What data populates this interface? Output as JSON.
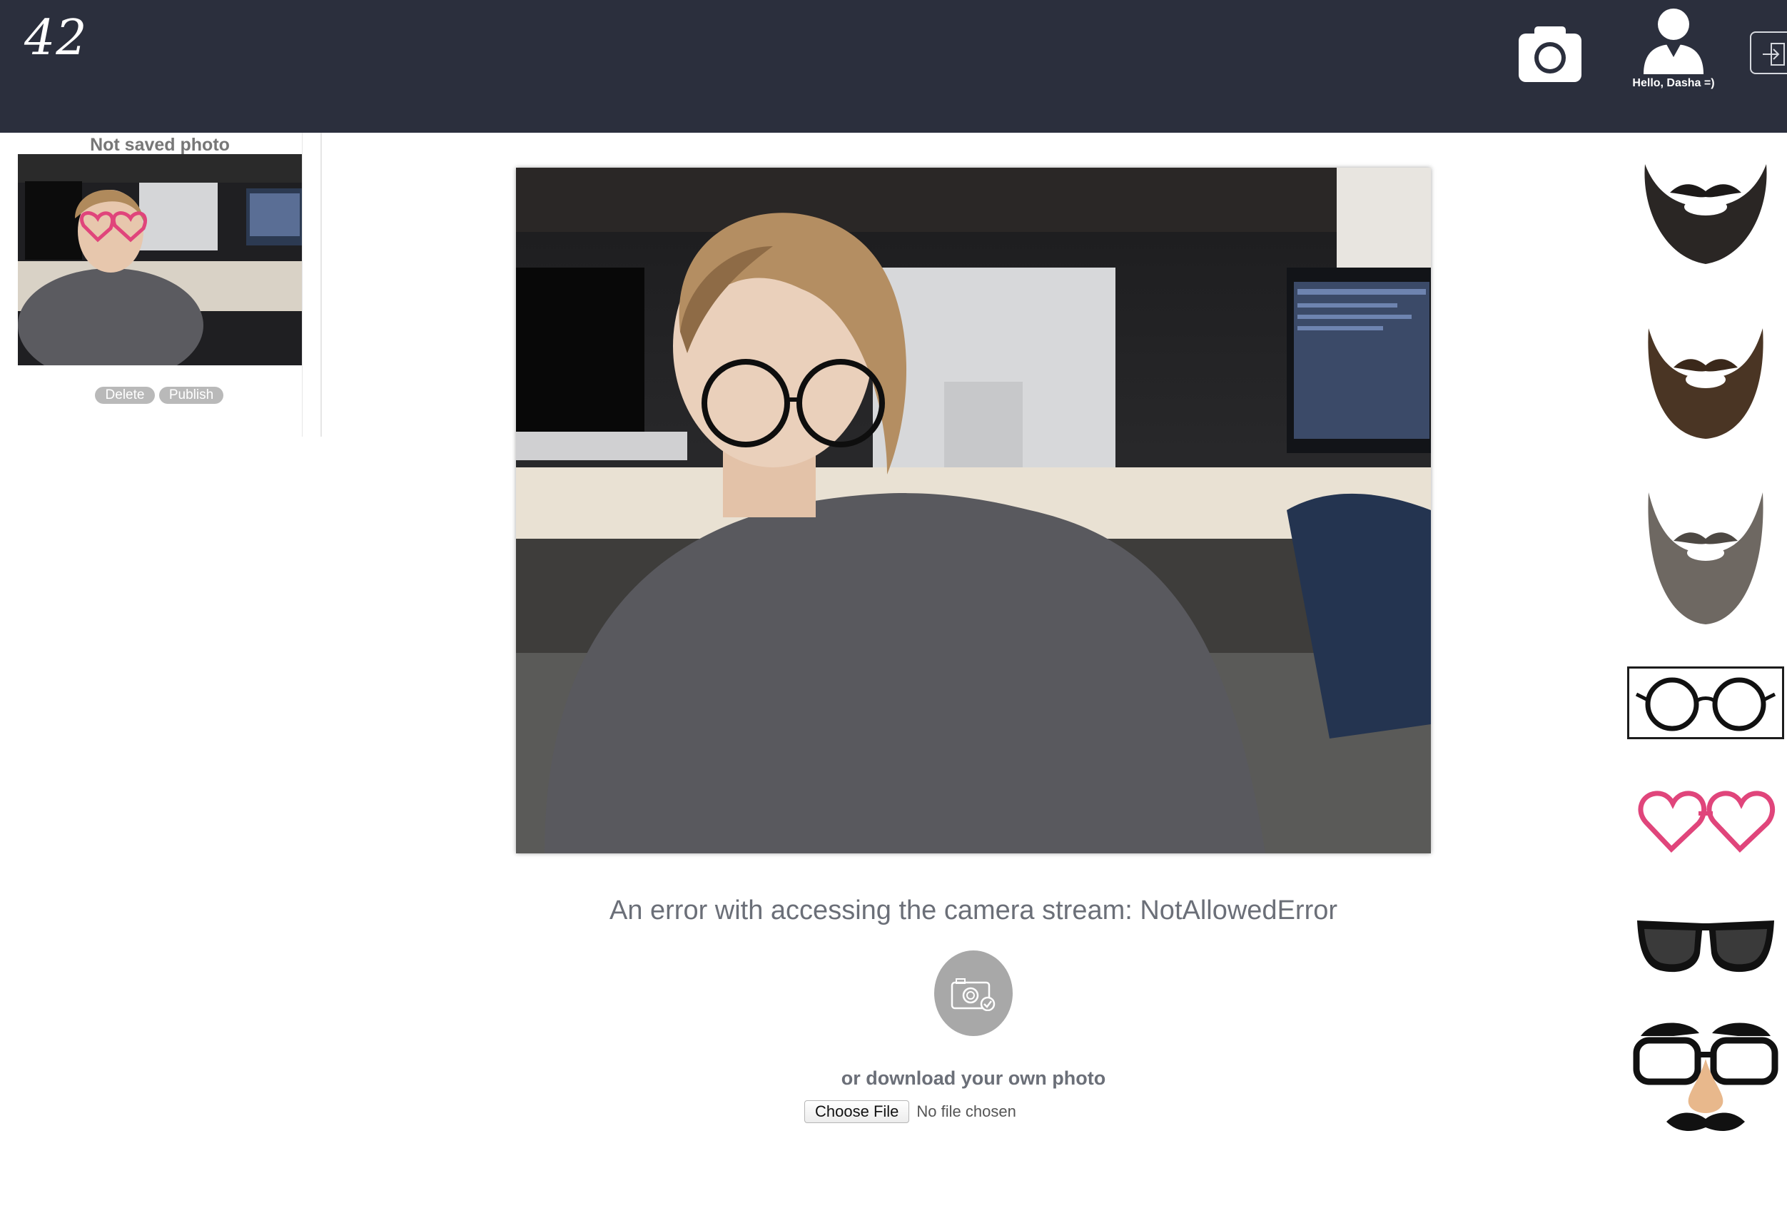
{
  "header": {
    "logo_text": "42",
    "camera_button_icon": "camera-icon",
    "user_icon": "user-icon",
    "greeting": "Hello, Dasha =)",
    "logout_icon": "logout-icon"
  },
  "gallery": {
    "title": "Not saved photo",
    "delete_label": "Delete",
    "publish_label": "Publish"
  },
  "main": {
    "error_message": "An error with accessing the camera stream: NotAllowedError",
    "snap_icon": "camera-check-icon",
    "download_prompt": "or download your own photo",
    "choose_file_label": "Choose File",
    "file_status": "No file chosen"
  },
  "stickers": [
    {
      "name": "beard-dark",
      "selected": false
    },
    {
      "name": "beard-brown",
      "selected": false
    },
    {
      "name": "beard-grey",
      "selected": false
    },
    {
      "name": "round-glasses",
      "selected": true
    },
    {
      "name": "heart-glasses",
      "selected": false
    },
    {
      "name": "sunglasses",
      "selected": false
    },
    {
      "name": "groucho-glasses",
      "selected": false
    }
  ],
  "colors": {
    "header_bg": "#2b2f3d",
    "muted_text": "#6b6f78",
    "heart_pink": "#e0457b"
  }
}
